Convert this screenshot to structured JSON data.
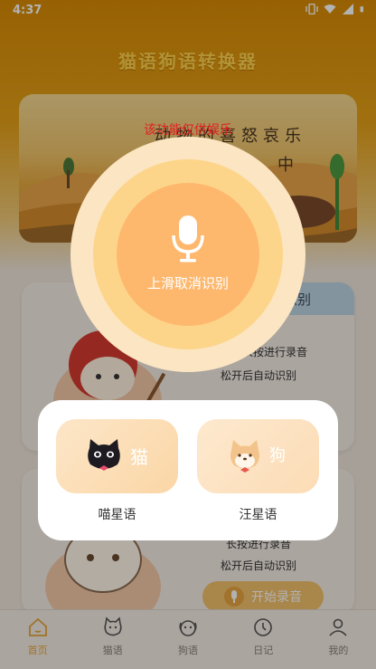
{
  "status_bar": {
    "time": "4:37"
  },
  "app": {
    "title": "猫语狗语转换器"
  },
  "banner": {
    "title": "动物的喜怒哀乐",
    "subtitle": "中"
  },
  "cat_card": {
    "tag": "识别",
    "line1": "长按进行录音",
    "line2": "松开后自动识别"
  },
  "dog_card": {
    "line1": "长按进行录音",
    "line2": "松开后自动识别",
    "button": "开始录音"
  },
  "overlay": {
    "disclaimer": "该功能仅供娱乐",
    "cancel_hint": "上滑取消识别",
    "modes": [
      {
        "char": "猫",
        "label": "喵星语"
      },
      {
        "char": "狗",
        "label": "汪星语"
      }
    ]
  },
  "tabbar": {
    "items": [
      {
        "label": "首页",
        "icon": "home-icon",
        "active": true
      },
      {
        "label": "猫语",
        "icon": "cat-icon",
        "active": false
      },
      {
        "label": "狗语",
        "icon": "dog-icon",
        "active": false
      },
      {
        "label": "日记",
        "icon": "clock-icon",
        "active": false
      },
      {
        "label": "我的",
        "icon": "person-icon",
        "active": false
      }
    ]
  },
  "colors": {
    "accent": "#e5a53a",
    "disclaimer": "#e31e1e",
    "ring_outer": "#fbe5c3",
    "ring_mid": "#fdd58a",
    "ring_inner": "#fdb86e"
  }
}
